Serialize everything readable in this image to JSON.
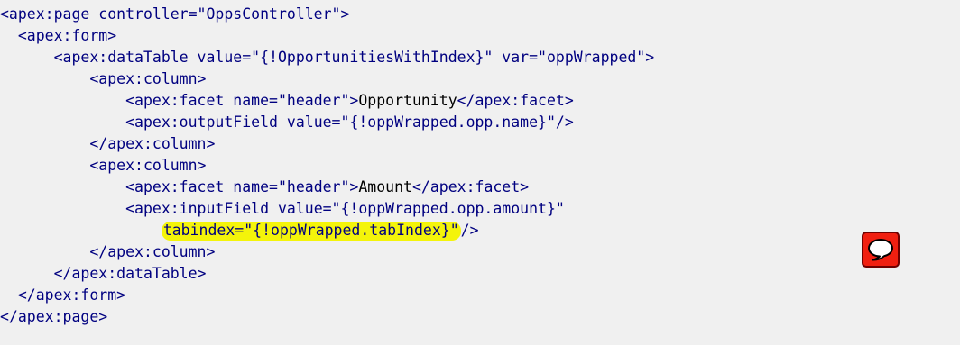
{
  "code_lines": [
    [
      {
        "t": "tag",
        "v": "<apex:page controller=\"OppsController\">"
      }
    ],
    [
      {
        "t": "text",
        "v": "  "
      },
      {
        "t": "tag",
        "v": "<apex:form>"
      }
    ],
    [
      {
        "t": "text",
        "v": "      "
      },
      {
        "t": "tag",
        "v": "<apex:dataTable value=\"{!OpportunitiesWithIndex}\" var=\"oppWrapped\">"
      }
    ],
    [
      {
        "t": "text",
        "v": "          "
      },
      {
        "t": "tag",
        "v": "<apex:column>"
      }
    ],
    [
      {
        "t": "text",
        "v": "              "
      },
      {
        "t": "tag",
        "v": "<apex:facet name=\"header\">"
      },
      {
        "t": "text",
        "v": "Opportunity"
      },
      {
        "t": "tag",
        "v": "</apex:facet>"
      }
    ],
    [
      {
        "t": "text",
        "v": "              "
      },
      {
        "t": "tag",
        "v": "<apex:outputField value=\"{!oppWrapped.opp.name}\"/>"
      }
    ],
    [
      {
        "t": "text",
        "v": "          "
      },
      {
        "t": "tag",
        "v": "</apex:column>"
      }
    ],
    [
      {
        "t": "text",
        "v": "          "
      },
      {
        "t": "tag",
        "v": "<apex:column>"
      }
    ],
    [
      {
        "t": "text",
        "v": "              "
      },
      {
        "t": "tag",
        "v": "<apex:facet name=\"header\">"
      },
      {
        "t": "text",
        "v": "Amount"
      },
      {
        "t": "tag",
        "v": "</apex:facet>"
      }
    ],
    [
      {
        "t": "text",
        "v": "              "
      },
      {
        "t": "tag",
        "v": "<apex:inputField value=\"{!oppWrapped.opp.amount}\""
      }
    ],
    [
      {
        "t": "text",
        "v": "                  "
      },
      {
        "t": "hl",
        "v": "tabindex=\"{!oppWrapped.tabIndex}\""
      },
      {
        "t": "tag",
        "v": "/>"
      }
    ],
    [
      {
        "t": "text",
        "v": "          "
      },
      {
        "t": "tag",
        "v": "</apex:column>"
      }
    ],
    [
      {
        "t": "text",
        "v": "      "
      },
      {
        "t": "tag",
        "v": "</apex:dataTable>"
      }
    ],
    [
      {
        "t": "text",
        "v": "  "
      },
      {
        "t": "tag",
        "v": "</apex:form>"
      }
    ],
    [
      {
        "t": "tag",
        "v": "</apex:page>"
      }
    ]
  ],
  "colors": {
    "background": "#f0f0f0",
    "tag": "#000080",
    "text": "#000000",
    "highlight": "#f4f40a",
    "comment_button": "#f01f10"
  },
  "comment_button": {
    "icon": "speech-bubble-icon"
  }
}
